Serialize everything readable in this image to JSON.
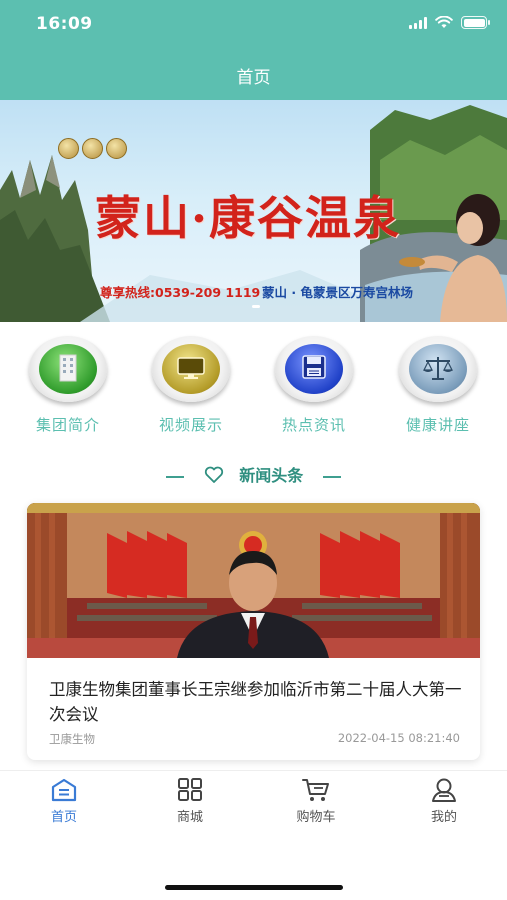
{
  "status_bar": {
    "time": "16:09"
  },
  "header": {
    "title": "首页"
  },
  "banner": {
    "title": "蒙山·康谷温泉",
    "hotline": "尊享热线:0539-209 1119",
    "address": "蒙山 · 龟蒙景区万寿宫林场"
  },
  "menu": [
    {
      "label": "集团简介",
      "icon": "building-icon",
      "color": "#3aa93a"
    },
    {
      "label": "视频展示",
      "icon": "monitor-icon",
      "color": "#b9a530"
    },
    {
      "label": "热点资讯",
      "icon": "floppy-disk-icon",
      "color": "#2346b8"
    },
    {
      "label": "健康讲座",
      "icon": "scales-icon",
      "color": "#6a8fb0"
    }
  ],
  "section": {
    "title": "新闻头条"
  },
  "news": [
    {
      "title": "卫康生物集团董事长王宗继参加临沂市第二十届人大第一次会议",
      "source": "卫康生物",
      "time": "2022-04-15 08:21:40"
    }
  ],
  "tabs": [
    {
      "label": "首页",
      "icon": "home-icon",
      "active": true
    },
    {
      "label": "商城",
      "icon": "grid-icon",
      "active": false
    },
    {
      "label": "购物车",
      "icon": "cart-icon",
      "active": false
    },
    {
      "label": "我的",
      "icon": "user-icon",
      "active": false
    }
  ],
  "colors": {
    "primary": "#5cbfb0",
    "tab_active": "#3a7bd5"
  }
}
